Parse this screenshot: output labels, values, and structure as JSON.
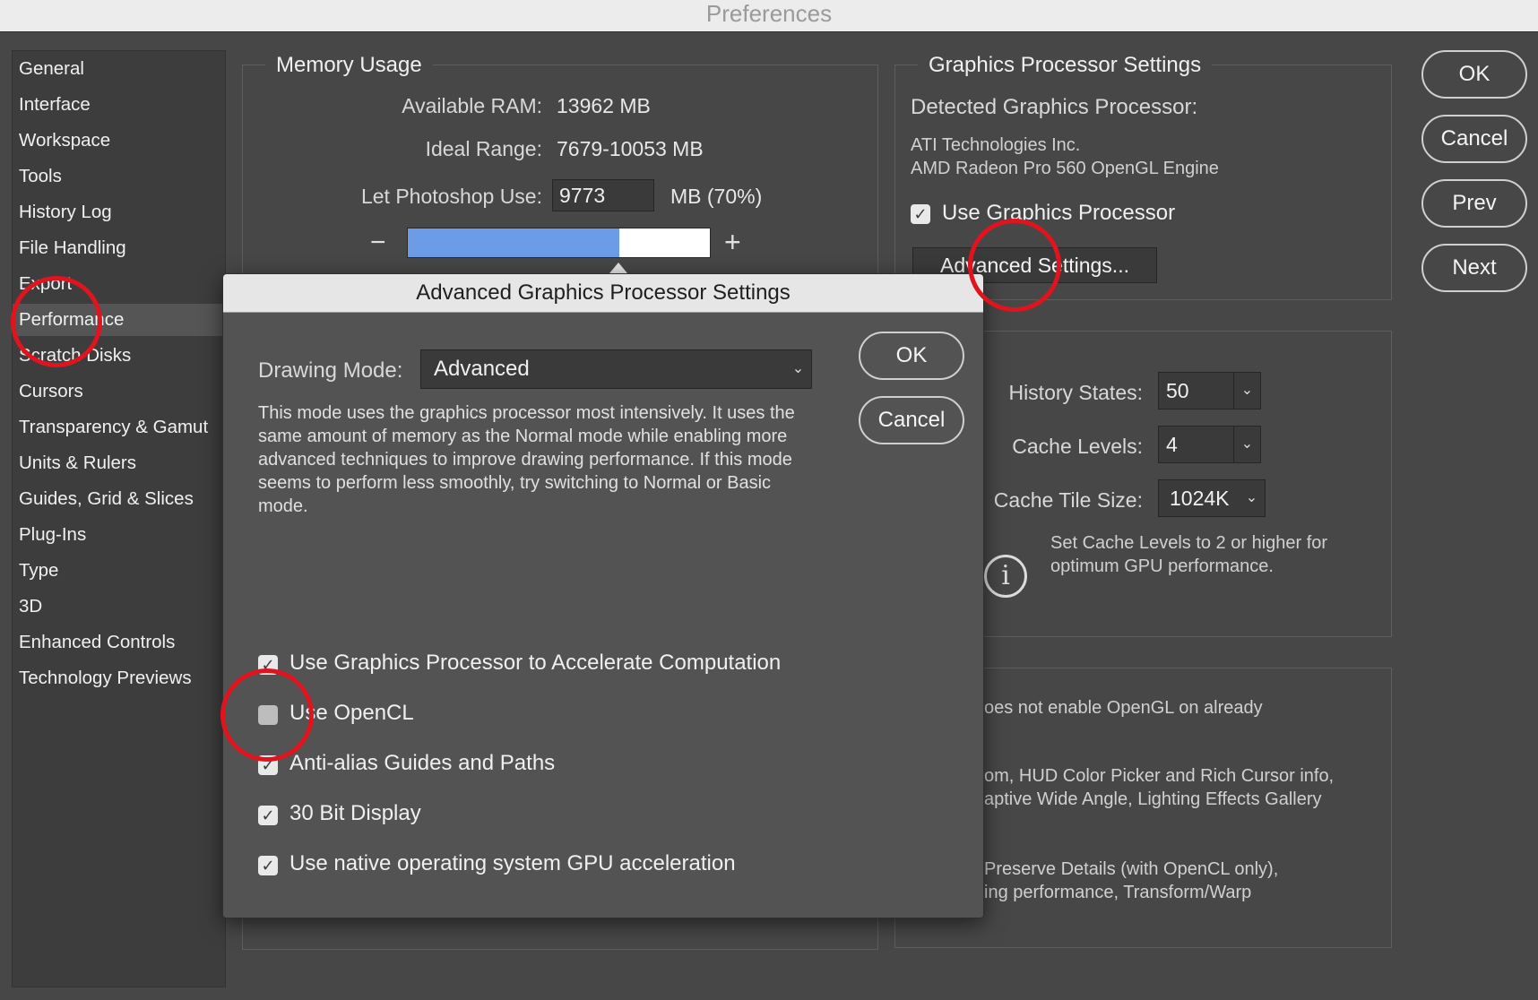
{
  "window": {
    "title": "Preferences"
  },
  "sidebar": {
    "items": [
      {
        "label": "General"
      },
      {
        "label": "Interface"
      },
      {
        "label": "Workspace"
      },
      {
        "label": "Tools"
      },
      {
        "label": "History Log"
      },
      {
        "label": "File Handling"
      },
      {
        "label": "Export"
      },
      {
        "label": "Performance"
      },
      {
        "label": "Scratch Disks"
      },
      {
        "label": "Cursors"
      },
      {
        "label": "Transparency & Gamut"
      },
      {
        "label": "Units & Rulers"
      },
      {
        "label": "Guides, Grid & Slices"
      },
      {
        "label": "Plug-Ins"
      },
      {
        "label": "Type"
      },
      {
        "label": "3D"
      },
      {
        "label": "Enhanced Controls"
      },
      {
        "label": "Technology Previews"
      }
    ],
    "selected": "Performance"
  },
  "memory": {
    "legend": "Memory Usage",
    "available_label": "Available RAM:",
    "available_value": "13962 MB",
    "ideal_label": "Ideal Range:",
    "ideal_value": "7679-10053 MB",
    "use_label": "Let Photoshop Use:",
    "use_value": "9773",
    "use_unit": "MB (70%)",
    "minus": "−",
    "plus": "+",
    "slider_fraction": 0.7
  },
  "gpu": {
    "legend": "Graphics Processor Settings",
    "detected_label": "Detected Graphics Processor:",
    "vendor": "ATI Technologies Inc.",
    "renderer": "AMD Radeon Pro 560 OpenGL Engine",
    "use_gpu_label": "Use Graphics Processor",
    "use_gpu_checked": true,
    "advanced_button": "Advanced Settings..."
  },
  "history": {
    "history_states_label": "History States:",
    "history_states_value": "50",
    "cache_levels_label": "Cache Levels:",
    "cache_levels_value": "4",
    "tile_size_label": "Cache Tile Size:",
    "tile_size_value": "1024K",
    "info_icon": "i",
    "info_text": "Set Cache Levels to 2 or higher for optimum GPU performance."
  },
  "description_panel": {
    "line1": "oes not enable OpenGL on already",
    "line2": "om, HUD Color Picker and Rich Cursor info,",
    "line3": "aptive Wide Angle, Lighting Effects Gallery",
    "line4": "Preserve Details (with OpenCL only),",
    "line5": "ing performance, Transform/Warp"
  },
  "buttons": {
    "ok": "OK",
    "cancel": "Cancel",
    "prev": "Prev",
    "next": "Next"
  },
  "dialog": {
    "title": "Advanced Graphics Processor Settings",
    "drawing_mode_label": "Drawing Mode:",
    "drawing_mode_value": "Advanced",
    "description": "This mode uses the graphics processor most intensively.  It uses the same amount of memory as the Normal mode while enabling more advanced techniques to improve drawing performance.  If this mode seems to perform less smoothly, try switching to Normal or Basic mode.",
    "ok": "OK",
    "cancel": "Cancel",
    "options": [
      {
        "label": "Use Graphics Processor to Accelerate Computation",
        "checked": true
      },
      {
        "label": "Use OpenCL",
        "checked": false
      },
      {
        "label": "Anti-alias Guides and Paths",
        "checked": true
      },
      {
        "label": "30 Bit Display",
        "checked": true
      },
      {
        "label": "Use native operating system GPU acceleration",
        "checked": true
      }
    ]
  },
  "colors": {
    "slider_fill": "#6c9be8",
    "annotation_circle": "#e0141e"
  }
}
